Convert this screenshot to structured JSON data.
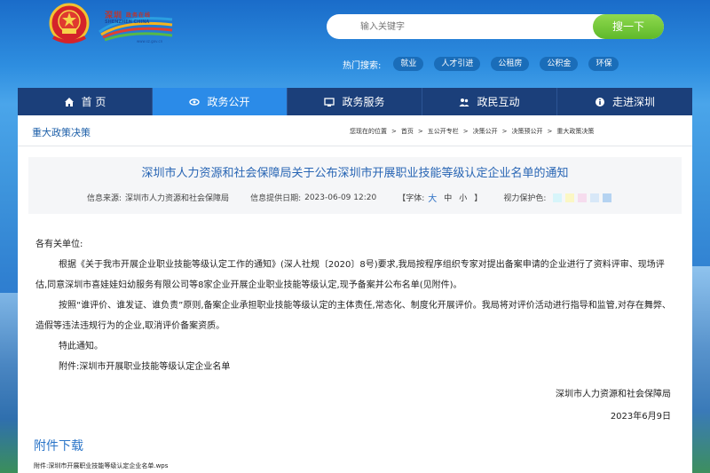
{
  "header": {
    "logo_title": "深圳",
    "logo_subtitle": "SHENZHEN CHINA",
    "logo_url": "www.sz.gov.cn",
    "logo_tag": "政务在线"
  },
  "search": {
    "placeholder": "输入关键字",
    "button_label": "搜一下"
  },
  "hot_search": {
    "label": "热门搜索:",
    "tags": [
      "就业",
      "人才引进",
      "公租房",
      "公积金",
      "环保"
    ]
  },
  "nav": {
    "items": [
      {
        "label": "首 页",
        "icon": "home-icon"
      },
      {
        "label": "政务公开",
        "icon": "open-icon"
      },
      {
        "label": "政务服务",
        "icon": "service-icon"
      },
      {
        "label": "政民互动",
        "icon": "people-icon"
      },
      {
        "label": "走进深圳",
        "icon": "info-icon"
      }
    ],
    "active_index": 1
  },
  "breadcrumb": {
    "section_title": "重大政策决策",
    "location_label": "您现在的位置",
    "items": [
      "首页",
      "五公开专栏",
      "决策公开",
      "决策预公开",
      "重大政策决策"
    ],
    "separator": ">"
  },
  "article": {
    "title": "深圳市人力资源和社会保障局关于公布深圳市开展职业技能等级认定企业名单的通知",
    "source_label": "信息来源:",
    "source": "深圳市人力资源和社会保障局",
    "date_label": "信息提供日期:",
    "date": "2023-06-09 12:20",
    "font_label": "【字体:",
    "font_options": [
      "大",
      "中",
      "小"
    ],
    "font_close": "】",
    "vision_label": "视力保护色:",
    "vision_colors": [
      "#d7f5fa",
      "#fbf7c4",
      "#f6dcee",
      "#d8e8f8",
      "#b5d3f1"
    ],
    "salutation": "各有关单位:",
    "paragraphs": [
      "根据《关于我市开展企业职业技能等级认定工作的通知》(深人社规〔2020〕8号)要求,我局按程序组织专家对提出备案申请的企业进行了资料评审、现场评估,同意深圳市喜娃娃妇幼服务有限公司等8家企业开展企业职业技能等级认定,现予备案并公布名单(见附件)。",
      "按照“谁评价、谁发证、谁负责”原则,备案企业承担职业技能等级认定的主体责任,常态化、制度化开展评价。我局将对评价活动进行指导和监管,对存在舞弊、造假等违法违规行为的企业,取消评价备案资质。"
    ],
    "closing": "特此通知。",
    "attachment_note": "附件:深圳市开展职业技能等级认定企业名单",
    "signature": "深圳市人力资源和社会保障局",
    "sign_date": "2023年6月9日"
  },
  "attachments": {
    "title": "附件下载",
    "file": "附件:深圳市开展职业技能等级认定企业名单.wps"
  },
  "colors": {
    "nav_bg": "#1b3f7a",
    "nav_active": "#2b8be8",
    "title_blue": "#2865b4",
    "search_button": "#6cc23a"
  }
}
